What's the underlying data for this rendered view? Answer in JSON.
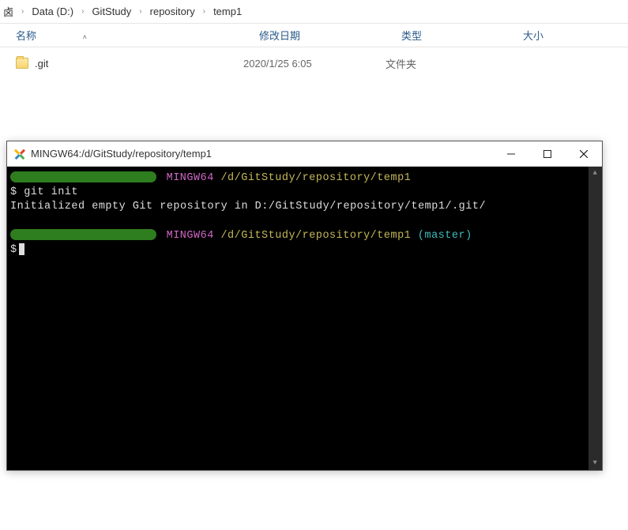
{
  "breadcrumb": {
    "parts": [
      "Data (D:)",
      "GitStudy",
      "repository",
      "temp1"
    ]
  },
  "explorer": {
    "headers": {
      "name": "名称",
      "date": "修改日期",
      "type": "类型",
      "size": "大小"
    },
    "rows": [
      {
        "name": ".git",
        "date": "2020/1/25 6:05",
        "type": "文件夹",
        "size": ""
      }
    ]
  },
  "terminal": {
    "title": "MINGW64:/d/GitStudy/repository/temp1",
    "lines": {
      "env1": "MINGW64",
      "path1": "/d/GitStudy/repository/temp1",
      "cmd1": "$ git init",
      "out1": "Initialized empty Git repository in D:/GitStudy/repository/temp1/.git/",
      "env2": "MINGW64",
      "path2": "/d/GitStudy/repository/temp1",
      "branch": "(master)",
      "prompt2": "$"
    }
  }
}
